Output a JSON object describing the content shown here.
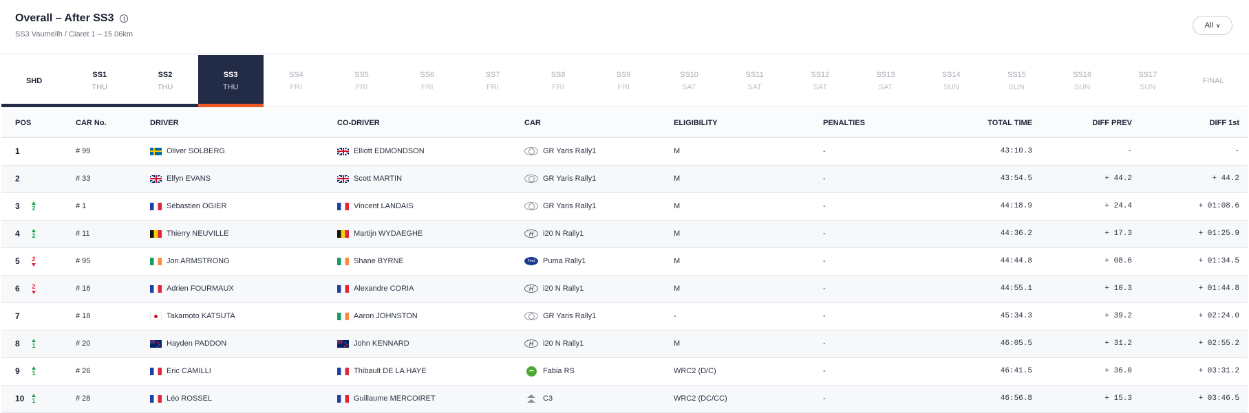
{
  "header": {
    "title": "Overall – After SS3",
    "info_glyph": "i",
    "subtitle": "SS3 Vaumeilh / Claret 1 – 15.06km",
    "filter": {
      "label": "All",
      "chevron": "∨"
    }
  },
  "stages": [
    {
      "name": "SHD",
      "day": "",
      "state": "done"
    },
    {
      "name": "SS1",
      "day": "THU",
      "state": "done"
    },
    {
      "name": "SS2",
      "day": "THU",
      "state": "done"
    },
    {
      "name": "SS3",
      "day": "THU",
      "state": "active"
    },
    {
      "name": "SS4",
      "day": "FRI",
      "state": "future"
    },
    {
      "name": "SS5",
      "day": "FRI",
      "state": "future"
    },
    {
      "name": "SS6",
      "day": "FRI",
      "state": "future"
    },
    {
      "name": "SS7",
      "day": "FRI",
      "state": "future"
    },
    {
      "name": "SS8",
      "day": "FRI",
      "state": "future"
    },
    {
      "name": "SS9",
      "day": "FRI",
      "state": "future"
    },
    {
      "name": "SS10",
      "day": "SAT",
      "state": "future"
    },
    {
      "name": "SS11",
      "day": "SAT",
      "state": "future"
    },
    {
      "name": "SS12",
      "day": "SAT",
      "state": "future"
    },
    {
      "name": "SS13",
      "day": "SAT",
      "state": "future"
    },
    {
      "name": "SS14",
      "day": "SUN",
      "state": "future"
    },
    {
      "name": "SS15",
      "day": "SUN",
      "state": "future"
    },
    {
      "name": "SS16",
      "day": "SUN",
      "state": "future"
    },
    {
      "name": "SS17",
      "day": "SUN",
      "state": "future"
    },
    {
      "name": "FINAL",
      "day": "",
      "state": "future"
    }
  ],
  "table": {
    "columns": {
      "pos": "POS",
      "car_no": "CAR No.",
      "driver": "DRIVER",
      "co_driver": "CO-DRIVER",
      "car": "CAR",
      "eligibility": "ELIGIBILITY",
      "penalties": "PENALTIES",
      "total_time": "TOTAL TIME",
      "diff_prev": "DIFF PREV",
      "diff_first": "DIFF 1st"
    },
    "rows": [
      {
        "pos": "1",
        "change": "",
        "dir": "",
        "car_no": "# 99",
        "driver": "Oliver SOLBERG",
        "driver_flag": "se",
        "co_driver": "Elliott EDMONDSON",
        "co_flag": "gb",
        "car": "GR Yaris Rally1",
        "brand": "toyota",
        "eligibility": "M",
        "penalties": "-",
        "total_time": "43:10.3",
        "diff_prev": "-",
        "diff_first": "-"
      },
      {
        "pos": "2",
        "change": "",
        "dir": "",
        "car_no": "# 33",
        "driver": "Elfyn EVANS",
        "driver_flag": "gb",
        "co_driver": "Scott MARTIN",
        "co_flag": "gb",
        "car": "GR Yaris Rally1",
        "brand": "toyota",
        "eligibility": "M",
        "penalties": "-",
        "total_time": "43:54.5",
        "diff_prev": "+ 44.2",
        "diff_first": "+ 44.2"
      },
      {
        "pos": "3",
        "change": "2",
        "dir": "up",
        "car_no": "# 1",
        "driver": "Sébastien OGIER",
        "driver_flag": "fr",
        "co_driver": "Vincent LANDAIS",
        "co_flag": "fr",
        "car": "GR Yaris Rally1",
        "brand": "toyota",
        "eligibility": "M",
        "penalties": "-",
        "total_time": "44:18.9",
        "diff_prev": "+ 24.4",
        "diff_first": "+ 01:08.6"
      },
      {
        "pos": "4",
        "change": "2",
        "dir": "up",
        "car_no": "# 11",
        "driver": "Thierry NEUVILLE",
        "driver_flag": "be",
        "co_driver": "Martijn WYDAEGHE",
        "co_flag": "be",
        "car": "i20 N Rally1",
        "brand": "hyundai",
        "eligibility": "M",
        "penalties": "-",
        "total_time": "44:36.2",
        "diff_prev": "+ 17.3",
        "diff_first": "+ 01:25.9"
      },
      {
        "pos": "5",
        "change": "2",
        "dir": "down",
        "car_no": "# 95",
        "driver": "Jon ARMSTRONG",
        "driver_flag": "ie",
        "co_driver": "Shane BYRNE",
        "co_flag": "ie",
        "car": "Puma Rally1",
        "brand": "ford",
        "eligibility": "M",
        "penalties": "-",
        "total_time": "44:44.8",
        "diff_prev": "+ 08.6",
        "diff_first": "+ 01:34.5"
      },
      {
        "pos": "6",
        "change": "2",
        "dir": "down",
        "car_no": "# 16",
        "driver": "Adrien FOURMAUX",
        "driver_flag": "fr",
        "co_driver": "Alexandre CORIA",
        "co_flag": "fr",
        "car": "i20 N Rally1",
        "brand": "hyundai",
        "eligibility": "M",
        "penalties": "-",
        "total_time": "44:55.1",
        "diff_prev": "+ 10.3",
        "diff_first": "+ 01:44.8"
      },
      {
        "pos": "7",
        "change": "",
        "dir": "",
        "car_no": "# 18",
        "driver": "Takamoto KATSUTA",
        "driver_flag": "jp",
        "co_driver": "Aaron JOHNSTON",
        "co_flag": "ie",
        "car": "GR Yaris Rally1",
        "brand": "toyota",
        "eligibility": "-",
        "penalties": "-",
        "total_time": "45:34.3",
        "diff_prev": "+ 39.2",
        "diff_first": "+ 02:24.0"
      },
      {
        "pos": "8",
        "change": "1",
        "dir": "up",
        "car_no": "# 20",
        "driver": "Hayden PADDON",
        "driver_flag": "nz",
        "co_driver": "John KENNARD",
        "co_flag": "nz",
        "car": "i20 N Rally1",
        "brand": "hyundai",
        "eligibility": "M",
        "penalties": "-",
        "total_time": "46:05.5",
        "diff_prev": "+ 31.2",
        "diff_first": "+ 02:55.2"
      },
      {
        "pos": "9",
        "change": "1",
        "dir": "up",
        "car_no": "# 26",
        "driver": "Eric CAMILLI",
        "driver_flag": "fr",
        "co_driver": "Thibault DE LA HAYE",
        "co_flag": "fr",
        "car": "Fabia RS",
        "brand": "skoda",
        "eligibility": "WRC2 (D/C)",
        "penalties": "-",
        "total_time": "46:41.5",
        "diff_prev": "+ 36.0",
        "diff_first": "+ 03:31.2"
      },
      {
        "pos": "10",
        "change": "1",
        "dir": "up",
        "car_no": "# 28",
        "driver": "Léo ROSSEL",
        "driver_flag": "fr",
        "co_driver": "Guillaume MERCOIRET",
        "co_flag": "fr",
        "car": "C3",
        "brand": "citroen",
        "eligibility": "WRC2 (DC/CC)",
        "penalties": "-",
        "total_time": "46:56.8",
        "diff_prev": "+ 15.3",
        "diff_first": "+ 03:46.5"
      }
    ]
  }
}
